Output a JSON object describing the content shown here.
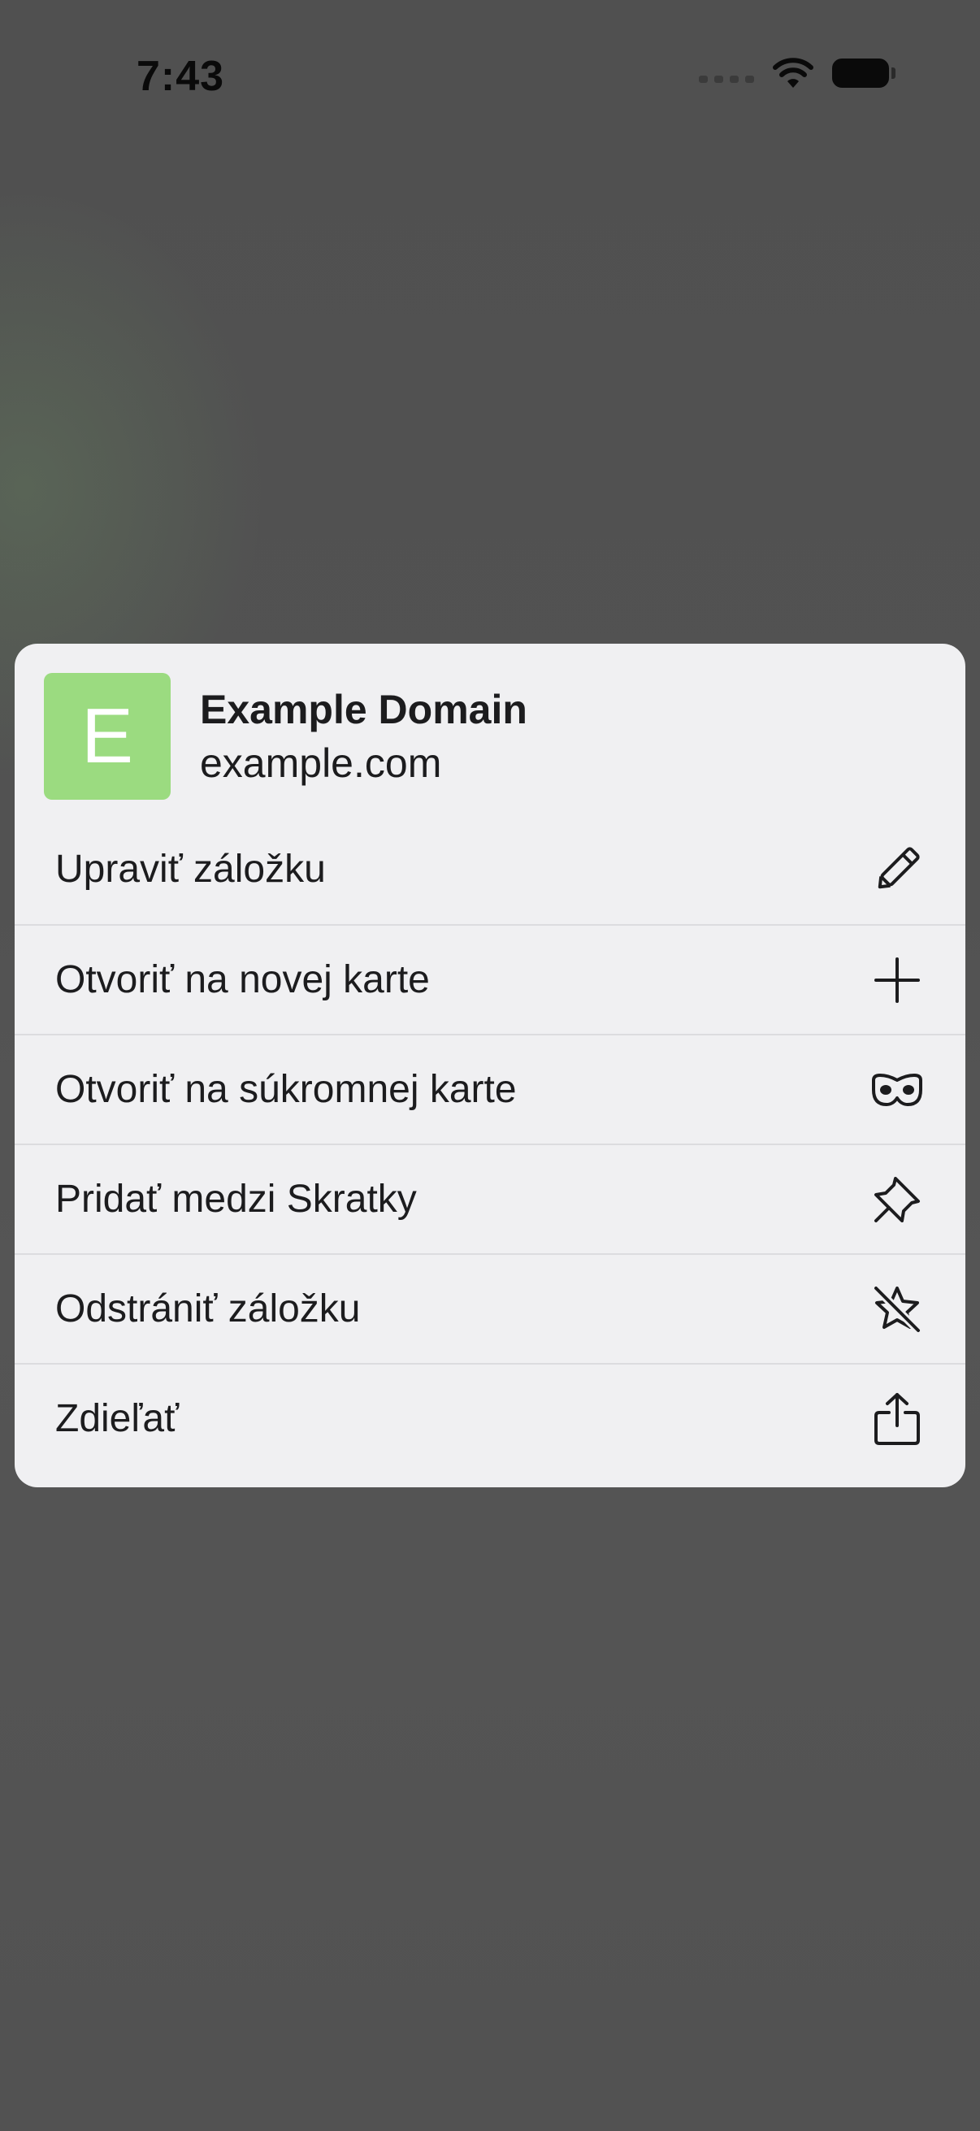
{
  "status_bar": {
    "time": "7:43"
  },
  "bookmark": {
    "favicon_letter": "E",
    "favicon_color": "#9bdb80",
    "title": "Example Domain",
    "url": "example.com"
  },
  "menu": {
    "items": [
      {
        "label": "Upraviť záložku",
        "icon": "pencil-icon"
      },
      {
        "label": "Otvoriť na novej karte",
        "icon": "plus-icon"
      },
      {
        "label": "Otvoriť na súkromnej karte",
        "icon": "private-mask-icon"
      },
      {
        "label": "Pridať medzi Skratky",
        "icon": "pin-icon"
      },
      {
        "label": "Odstrániť záložku",
        "icon": "star-slash-icon"
      },
      {
        "label": "Zdieľať",
        "icon": "share-icon"
      }
    ]
  }
}
